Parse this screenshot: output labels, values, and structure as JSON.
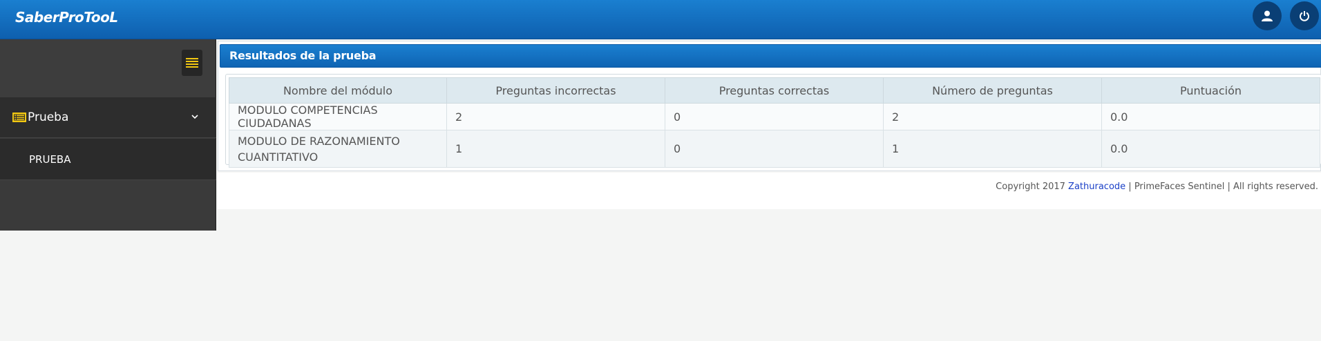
{
  "header": {
    "logo": "SaberProTooL",
    "user_icon": "user-icon",
    "power_icon": "power-icon"
  },
  "sidebar": {
    "toggle_icon": "menu-lines-icon",
    "menu": {
      "label": "Prueba",
      "icon": "list-icon",
      "chevron": "chevron-down-icon",
      "items": [
        {
          "label": "PRUEBA"
        }
      ]
    }
  },
  "panel": {
    "title": "Resultados de la prueba",
    "columns": [
      "Nombre del módulo",
      "Preguntas incorrectas",
      "Preguntas correctas",
      "Número de preguntas",
      "Puntuación"
    ],
    "rows": [
      [
        "MODULO COMPETENCIAS CIUDADANAS",
        "2",
        "0",
        "2",
        "0.0"
      ],
      [
        "MODULO DE RAZONAMIENTO CUANTITATIVO",
        "1",
        "0",
        "1",
        "0.0"
      ]
    ]
  },
  "footer": {
    "prefix": "Copyright 2017 ",
    "link": "Zathuracode",
    "suffix": " | PrimeFaces Sentinel | All rights reserved."
  },
  "colors": {
    "brand_blue": "#1a7fd0",
    "sidebar_dark": "#2d2d2d",
    "accent_yellow": "#f2c811"
  }
}
